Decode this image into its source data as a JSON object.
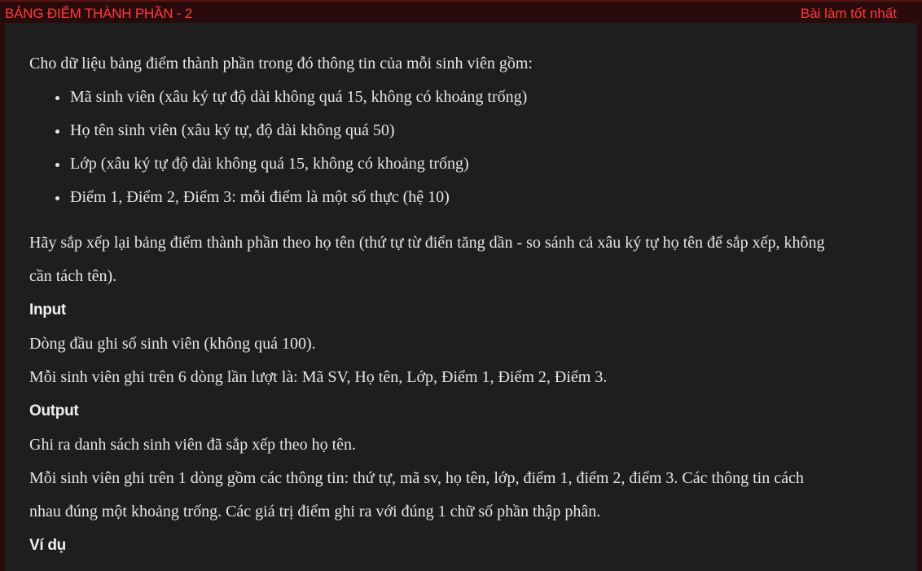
{
  "header": {
    "title": "BẢNG ĐIỂM THÀNH PHẦN - 2",
    "best_link": "Bài làm tốt nhất",
    "accent_color": "#ff3b3b"
  },
  "problem": {
    "intro": "Cho dữ liệu bảng điểm thành phần trong đó thông tin của mỗi sinh viên gồm:",
    "fields": [
      "Mã sinh viên (xâu ký tự độ dài không quá 15, không có khoảng trống)",
      "Họ tên sinh viên (xâu ký tự, độ dài không quá 50)",
      "Lớp (xâu ký tự độ dài không quá 15, không có khoảng trống)",
      "Điểm 1, Điểm 2, Điểm 3: mỗi điểm là một số thực (hệ 10)"
    ],
    "task_line1": "Hãy sắp xếp lại bảng điểm thành phần theo họ tên (thứ tự từ điển tăng dần - so sánh cả xâu ký tự họ tên để sắp xếp, không",
    "task_line2": "cần tách tên).",
    "input_heading": "Input",
    "input_lines": [
      "Dòng đầu ghi số sinh viên (không quá 100).",
      "Mỗi sinh viên ghi trên 6 dòng lần lượt là: Mã SV, Họ tên, Lớp, Điểm 1, Điểm 2, Điểm 3."
    ],
    "output_heading": "Output",
    "output_lines": [
      "Ghi ra danh sách sinh viên đã sắp xếp theo họ tên.",
      "Mỗi sinh viên ghi trên 1 dòng gồm các thông tin: thứ tự, mã sv, họ tên, lớp, điểm 1, điểm 2, điểm 3. Các thông tin cách",
      "nhau đúng một khoảng trống. Các giá trị điểm ghi ra với đúng 1 chữ số phần thập phân."
    ],
    "example_heading": "Ví dụ"
  }
}
